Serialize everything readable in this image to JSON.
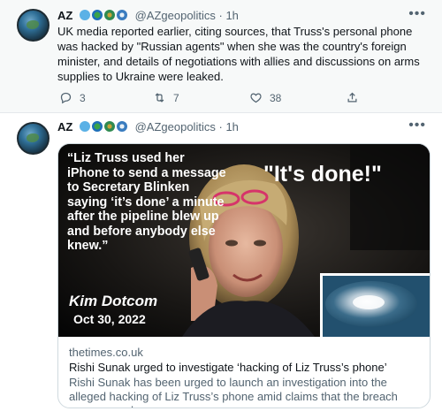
{
  "tweets": [
    {
      "author": {
        "name": "AZ",
        "handle": "@AZgeopolitics",
        "separator": "·",
        "time": "1h"
      },
      "text": "UK media reported earlier, citing sources, that Truss's personal phone was hacked by \"Russian agents\" when she was the country's foreign minister, and details of negotiations with allies and discussions on arms supplies to Ukraine were leaked.",
      "stats": {
        "replies": "3",
        "retweets": "7",
        "likes": "38"
      }
    },
    {
      "author": {
        "name": "AZ",
        "handle": "@AZgeopolitics",
        "separator": "·",
        "time": "1h"
      },
      "card": {
        "image_quote": "“Liz Truss used her iPhone to send a message to Secretary Blinken saying ‘it’s done’ a minute after the pipeline blew up and before anybody else knew.”",
        "image_headline": "\"It's done!\"",
        "image_author": "Kim Dotcom",
        "image_date": "Oct 30, 2022",
        "domain": "thetimes.co.uk",
        "title": "Rishi Sunak urged to investigate ‘hacking of Liz Truss’s phone’",
        "description": "Rishi Sunak has been urged to launch an investigation into the alleged hacking of Liz Truss’s phone amid claims that the breach was covered ..."
      }
    }
  ],
  "icons": {
    "more": "more-horizontal-icon",
    "reply": "reply-icon",
    "retweet": "retweet-icon",
    "like": "heart-icon",
    "share": "share-icon"
  },
  "colors": {
    "text_primary": "#0f1419",
    "text_secondary": "#536471",
    "focused_background": "#f7f9f9",
    "border": "#cfd9de"
  }
}
